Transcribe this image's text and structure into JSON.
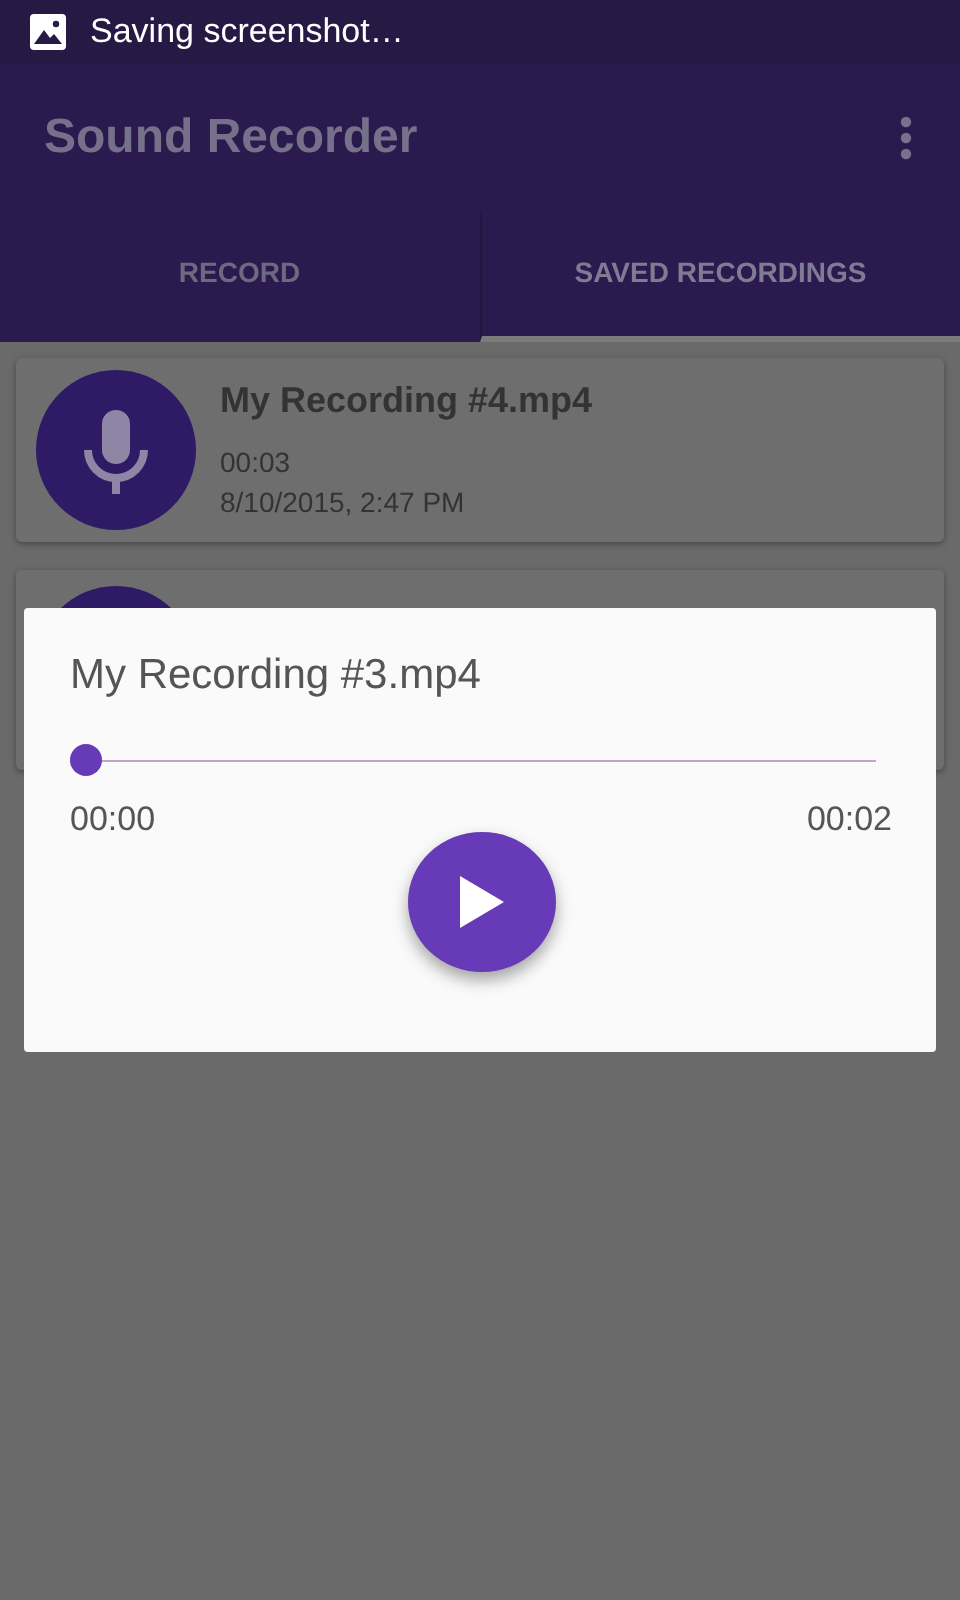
{
  "status_bar": {
    "notification": "Saving screenshot…"
  },
  "app_bar": {
    "title": "Sound Recorder"
  },
  "tabs": [
    {
      "label": "RECORD",
      "selected": false
    },
    {
      "label": "SAVED RECORDINGS",
      "selected": true
    }
  ],
  "recordings": [
    {
      "name": "My Recording #4.mp4",
      "length": "00:03",
      "date": "8/10/2015, 2:47 PM"
    },
    {
      "kind": "covered"
    }
  ],
  "dialog": {
    "title": "My Recording #3.mp4",
    "progress": {
      "level": 0
    },
    "elapsed": "00:00",
    "duration": "00:02",
    "playing": false
  }
}
